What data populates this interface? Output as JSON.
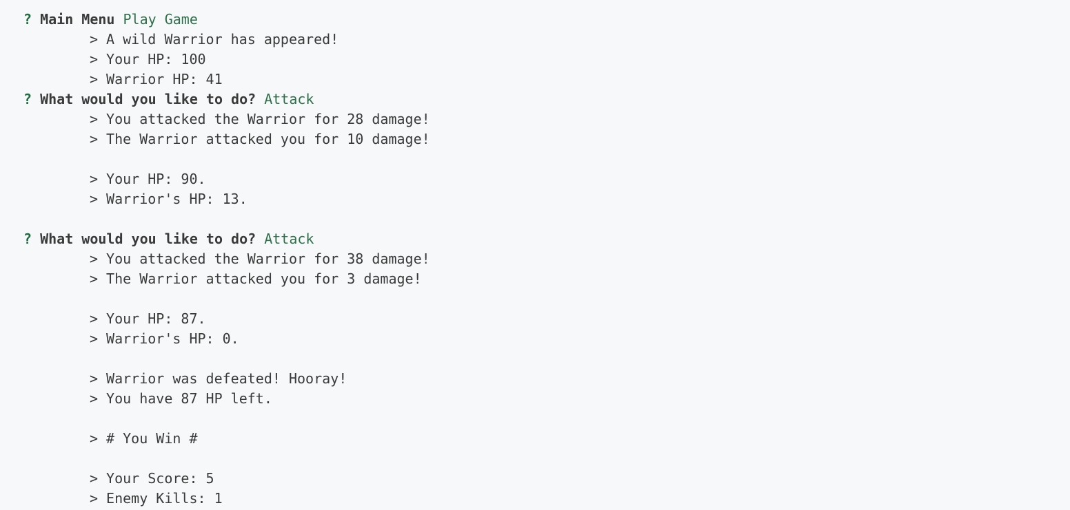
{
  "colors": {
    "background": "#f6f8fa",
    "text": "#3a3a3a",
    "question_mark": "#1f6b3f",
    "answer": "#2f6f4a"
  },
  "prompt_symbol": "?",
  "output_symbol": ">",
  "lines": [
    {
      "kind": "prompt",
      "question": "Main Menu",
      "answer": "Play Game"
    },
    {
      "kind": "output",
      "text": "A wild Warrior has appeared!"
    },
    {
      "kind": "output",
      "text": "Your HP: 100"
    },
    {
      "kind": "output",
      "text": "Warrior HP: 41"
    },
    {
      "kind": "prompt",
      "question": "What would you like to do?",
      "answer": "Attack"
    },
    {
      "kind": "output",
      "text": "You attacked the Warrior for 28 damage!"
    },
    {
      "kind": "output",
      "text": "The Warrior attacked you for 10 damage!"
    },
    {
      "kind": "blank"
    },
    {
      "kind": "output",
      "text": "Your HP: 90."
    },
    {
      "kind": "output",
      "text": "Warrior's HP: 13."
    },
    {
      "kind": "blank"
    },
    {
      "kind": "prompt",
      "question": "What would you like to do?",
      "answer": "Attack"
    },
    {
      "kind": "output",
      "text": "You attacked the Warrior for 38 damage!"
    },
    {
      "kind": "output",
      "text": "The Warrior attacked you for 3 damage!"
    },
    {
      "kind": "blank"
    },
    {
      "kind": "output",
      "text": "Your HP: 87."
    },
    {
      "kind": "output",
      "text": "Warrior's HP: 0."
    },
    {
      "kind": "blank"
    },
    {
      "kind": "output",
      "text": "Warrior was defeated! Hooray!"
    },
    {
      "kind": "output",
      "text": "You have 87 HP left."
    },
    {
      "kind": "blank"
    },
    {
      "kind": "output",
      "text": "# You Win #"
    },
    {
      "kind": "blank"
    },
    {
      "kind": "output",
      "text": "Your Score: 5"
    },
    {
      "kind": "output",
      "text": "Enemy Kills: 1"
    }
  ]
}
